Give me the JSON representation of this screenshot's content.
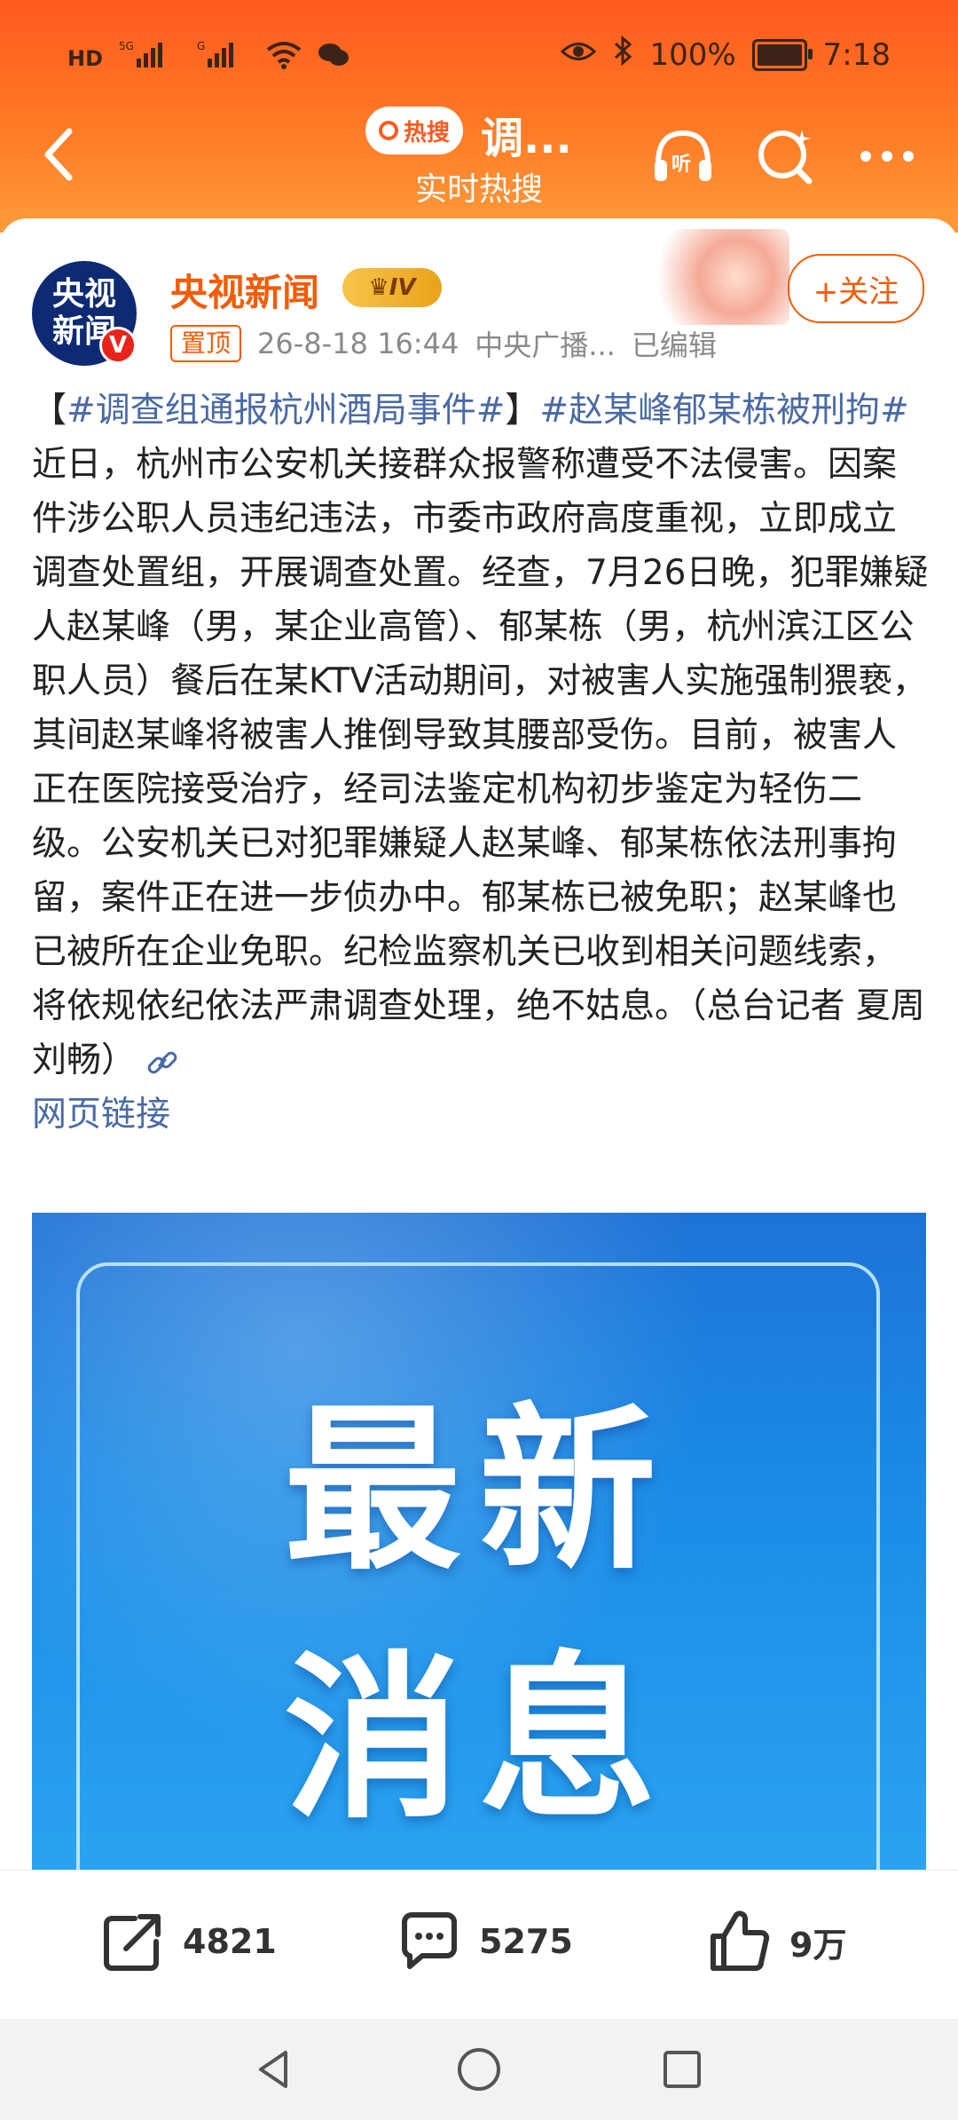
{
  "status_bar": {
    "network_tag": "HD",
    "signal1": "5G",
    "signal2": "G",
    "battery_text": "100%",
    "time": "7:18"
  },
  "header": {
    "hot_pill": "热搜",
    "title": "调...",
    "subtitle": "实时热搜"
  },
  "post": {
    "avatar_line1": "央视",
    "avatar_line2": "新闻",
    "verified_badge": "V",
    "author": "央视新闻",
    "level": "IV",
    "pin_label": "置顶",
    "timestamp": "26-8-18 16:44",
    "source": "中央广播...",
    "edited": "已编辑",
    "follow_label": "+关注",
    "bracket_open": "【",
    "tag1": "#调查组通报杭州酒局事件#",
    "bracket_close": "】",
    "tag2": "#赵某峰郁某栋被刑拘#",
    "body": " 近日，杭州市公安机关接群众报警称遭受不法侵害。因案件涉公职人员违纪违法，市委市政府高度重视，立即成立调查处置组，开展调查处置。经查，7月26日晚，犯罪嫌疑人赵某峰（男，某企业高管）、郁某栋（男，杭州滨江区公职人员）餐后在某KTV活动期间，对被害人实施强制猥亵，其间赵某峰将被害人推倒导致其腰部受伤。目前，被害人正在医院接受治疗，经司法鉴定机构初步鉴定为轻伤二级。公安机关已对犯罪嫌疑人赵某峰、郁某栋依法刑事拘留，案件正在进一步侦办中。郁某栋已被免职；赵某峰也已被所在企业免职。纪检监察机关已收到相关问题线索，将依规依纪依法严肃调查处理，绝不姑息。（总台记者 夏周 刘畅）",
    "link_label": "网页链接",
    "image_text_line1": "最新",
    "image_text_line2": "消息"
  },
  "actions": {
    "share_count": "4821",
    "comment_count": "5275",
    "like_count": "9万"
  },
  "colors": {
    "header_orange": "#ff6a22",
    "brand_orange": "#f25c05",
    "hashtag_blue": "#4a6aa5",
    "news_blue": "#1a8ae6"
  },
  "icons": {
    "back": "chevron-left-icon",
    "listen": "headphones-icon",
    "search": "search-icon",
    "more": "more-icon",
    "share": "share-icon",
    "comment": "comment-icon",
    "like": "thumbs-up-icon",
    "link": "link-icon"
  }
}
